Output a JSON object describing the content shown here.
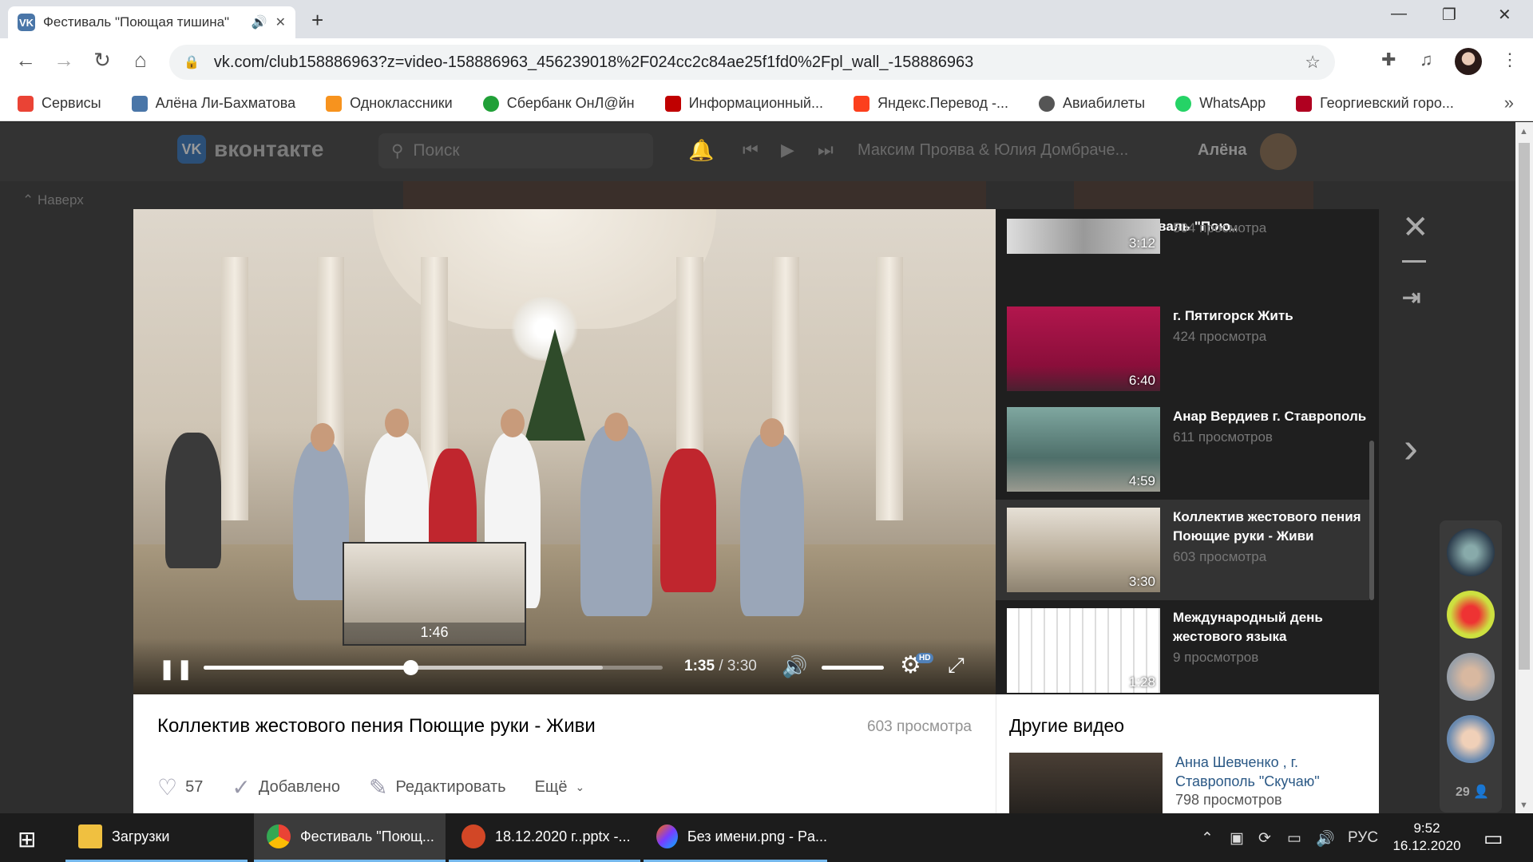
{
  "browser": {
    "tab_title": "Фестиваль \"Поющая тишина\"",
    "url": "vk.com/club158886963?z=video-158886963_456239018%2F024cc2c84ae25f1fd0%2Fpl_wall_-158886963",
    "bookmarks": [
      {
        "label": "Сервисы",
        "color": "#ea4335"
      },
      {
        "label": "Алёна Ли-Бахматова",
        "color": "#4a76a8"
      },
      {
        "label": "Одноклассники",
        "color": "#f7931e"
      },
      {
        "label": "Сбербанк ОнЛ@йн",
        "color": "#21a038"
      },
      {
        "label": "Информационный...",
        "color": "#c00000"
      },
      {
        "label": "Яндекс.Перевод -...",
        "color": "#fc3f1d"
      },
      {
        "label": "Авиабилеты",
        "color": "#555555"
      },
      {
        "label": "WhatsApp",
        "color": "#25d366"
      },
      {
        "label": "Георгиевский горо...",
        "color": "#b00020"
      }
    ]
  },
  "vk": {
    "logo_text": "вконтакте",
    "search_placeholder": "Поиск",
    "now_playing": "Максим Проява & Юлия Домбраче...",
    "user_name": "Алёна",
    "up_label": "Наверх"
  },
  "player": {
    "preview_time": "1:46",
    "current_time": "1:35",
    "total_time": "3:30",
    "played_fraction": 0.45,
    "buffered_fraction": 0.87,
    "volume_fraction": 1.0,
    "hd_badge": "HD"
  },
  "playlist": {
    "title": "Видео на стене Фестиваль \"Пою..",
    "items": [
      {
        "name": "",
        "views": "504 просмотра",
        "duration": "3:12",
        "active": false
      },
      {
        "name": "г. Пятигорск Жить",
        "views": "424 просмотра",
        "duration": "6:40",
        "active": false
      },
      {
        "name": "Анар Вердиев г. Ставрополь",
        "views": "611 просмотров",
        "duration": "4:59",
        "active": false
      },
      {
        "name": "Коллектив жестового пения Поющие руки - Живи",
        "views": "603 просмотра",
        "duration": "3:30",
        "active": true
      },
      {
        "name": "Международный день жестового языка",
        "views": "9 просмотров",
        "duration": "1:28",
        "active": false
      }
    ]
  },
  "video_info": {
    "title": "Коллектив жестового пения Поющие руки - Живи",
    "views": "603 просмотра",
    "likes": "57",
    "added_label": "Добавлено",
    "edit_label": "Редактировать",
    "more_label": "Ещё"
  },
  "other_videos": {
    "title": "Другие видео",
    "item_name": "Анна Шевченко , г. Ставрополь \"Скучаю\"",
    "item_views": "798 просмотров"
  },
  "friends": {
    "count": "29"
  },
  "taskbar": {
    "apps": [
      "Загрузки",
      "Фестиваль \"Поющ...",
      "18.12.2020 г..pptx -...",
      "Без имени.png - Pa..."
    ],
    "lang": "РУС",
    "time": "9:52",
    "date": "16.12.2020"
  }
}
